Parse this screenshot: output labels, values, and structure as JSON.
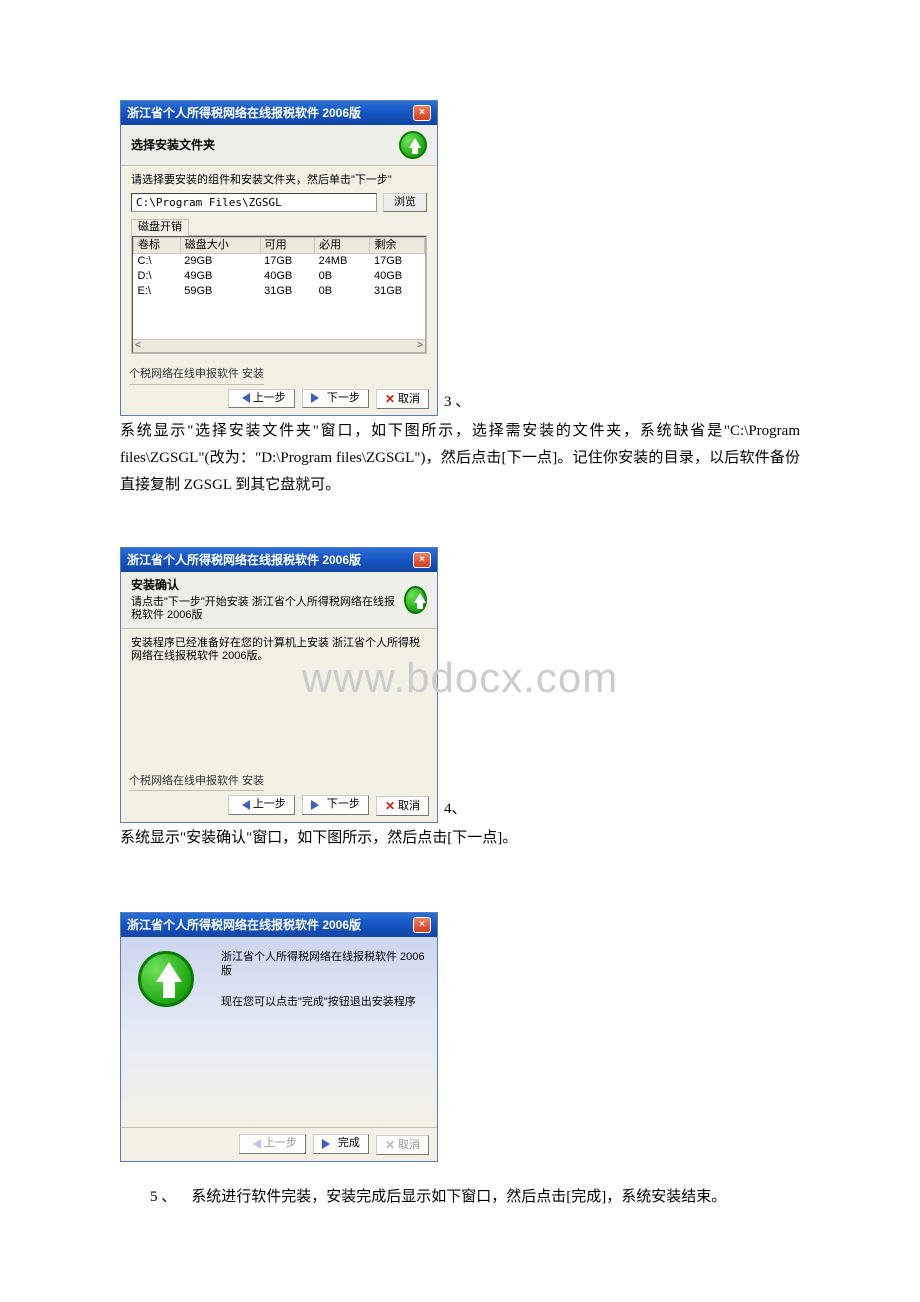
{
  "watermark": "www.bdocx.com",
  "dialog_shared": {
    "window_title": "浙江省个人所得税网络在线报税软件 2006版",
    "footer_label": "个税网络在线申报软件 安装",
    "btn_prev": "上一步",
    "btn_next": "下一步",
    "btn_cancel": "取消",
    "btn_finish": "完成"
  },
  "dlg1": {
    "heading": "选择安装文件夹",
    "instruction": "请选择要安装的组件和安装文件夹，然后单击\"下一步\"",
    "path_value": "C:\\Program Files\\ZGSGL",
    "browse": "浏览",
    "fieldset": "磁盘开销",
    "cols": [
      "卷标",
      "磁盘大小",
      "可用",
      "必用",
      "剩余"
    ],
    "rows": [
      [
        "C:\\",
        "29GB",
        "17GB",
        "24MB",
        "17GB"
      ],
      [
        "D:\\",
        "49GB",
        "40GB",
        "0B",
        "40GB"
      ],
      [
        "E:\\",
        "59GB",
        "31GB",
        "0B",
        "31GB"
      ]
    ]
  },
  "dlg2": {
    "heading": "安装确认",
    "subheading": "请点击\"下一步\"开始安装 浙江省个人所得税网络在线报税软件 2006版",
    "body_msg": "安装程序已经准备好在您的计算机上安装 浙江省个人所得税网络在线报税软件 2006版。"
  },
  "dlg3": {
    "line1": "浙江省个人所得税网络在线报税软件 2006版",
    "line2": "现在您可以点击\"完成\"按钮退出安装程序"
  },
  "step3": {
    "num": "3 、",
    "text_a": "系统显示\"选择安装文件夹\"窗口，如下图所示，选择需安装的文件夹，系统缺省是\"C:\\Program files\\ZGSGL\"(改为：\"D:\\Program files\\ZGSGL\")，然后点击[下一点]。记住你安装的目录，以后软件备份直接复制 ZGSGL 到其它盘就可。"
  },
  "step4": {
    "num": "4、",
    "text": "系统显示\"安装确认\"窗口，如下图所示，然后点击[下一点]。"
  },
  "step5": {
    "num": "5 、",
    "text": "系统进行软件完装，安装完成后显示如下窗口，然后点击[完成]，系统安装结束。"
  }
}
